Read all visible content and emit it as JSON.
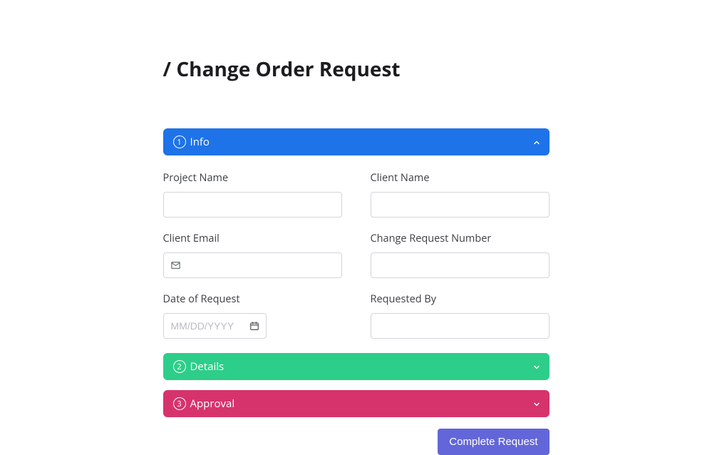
{
  "header": {
    "title": "/ Change Order Request"
  },
  "panels": {
    "info": {
      "step": "1",
      "label": "Info",
      "expanded": true
    },
    "details": {
      "step": "2",
      "label": "Details",
      "expanded": false
    },
    "approval": {
      "step": "3",
      "label": "Approval",
      "expanded": false
    }
  },
  "form": {
    "project_name": {
      "label": "Project Name",
      "value": ""
    },
    "client_name": {
      "label": "Client Name",
      "value": ""
    },
    "client_email": {
      "label": "Client Email",
      "value": ""
    },
    "change_request_number": {
      "label": "Change Request Number",
      "value": ""
    },
    "date_of_request": {
      "label": "Date of Request",
      "value": "",
      "placeholder": "MM/DD/YYYY"
    },
    "requested_by": {
      "label": "Requested By",
      "value": ""
    }
  },
  "actions": {
    "complete_request": "Complete Request"
  },
  "colors": {
    "info": "#1e73e8",
    "details": "#2dce89",
    "approval": "#d6336c",
    "primary_button": "#6366d8"
  }
}
